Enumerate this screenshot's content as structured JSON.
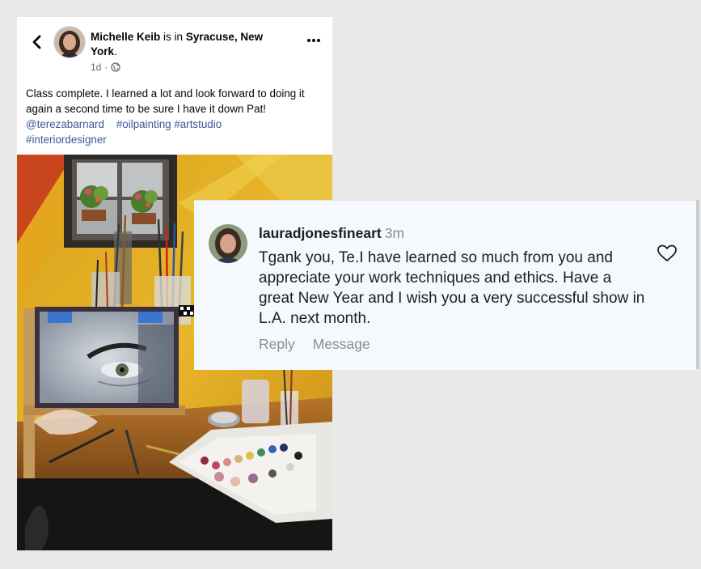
{
  "post": {
    "author": "Michelle Keib",
    "is_in": "is in",
    "location": "Syracuse, New York",
    "location_end": ".",
    "age": "1d",
    "dot": "·",
    "privacy_icon": "globe-icon",
    "more_icon": "more-horizontal-icon",
    "back_icon": "chevron-left-icon",
    "caption": "Class complete. I learned a lot and look forward to doing it again a second time to be sure I have it down Pat!",
    "mention": "@terezabarnard",
    "hashtags": [
      "#oilpainting",
      "#artstudio",
      "#interiordesigner"
    ],
    "link_color": "#385898"
  },
  "comment": {
    "username": "lauradjonesfineart",
    "time": "3m",
    "text": "Tgank you,  Te.I have learned so much from you and appreciate your work techniques and ethics.  Have a great New Year and I wish you a very successful show in L.A. next month.",
    "actions": {
      "reply": "Reply",
      "message": "Message"
    },
    "like_icon": "heart-outline-icon"
  }
}
